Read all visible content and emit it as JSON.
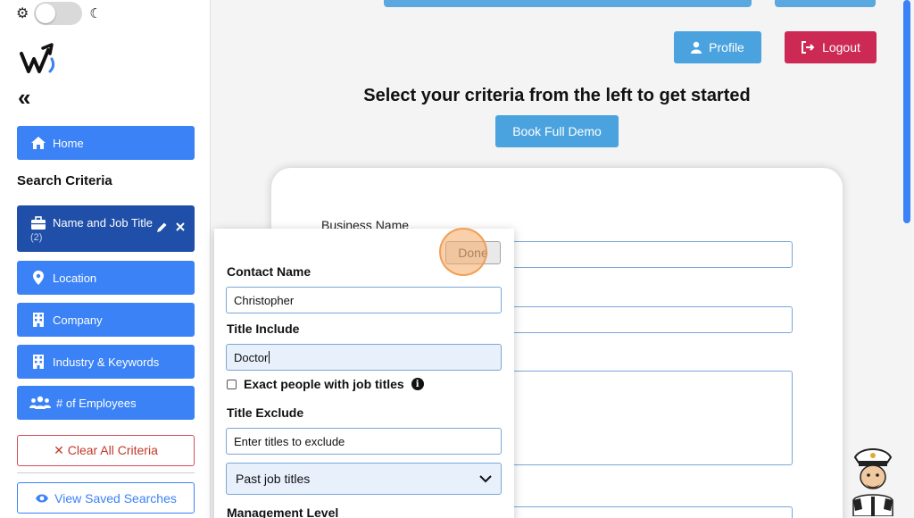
{
  "sidebar": {
    "collapse_glyph": "«",
    "nav_home": "Home",
    "section_title": "Search Criteria",
    "items": [
      {
        "label": "Name and Job Title",
        "sub": "(2)"
      },
      {
        "label": "Location"
      },
      {
        "label": "Company"
      },
      {
        "label": "Industry & Keywords"
      },
      {
        "label": "# of Employees"
      }
    ],
    "clear_label": "✕ Clear All Criteria",
    "saved_label": "View Saved Searches"
  },
  "header": {
    "profile_label": "Profile",
    "logout_label": "Logout",
    "headline": "Select your criteria from the left to get started",
    "demo_label": "Book Full Demo"
  },
  "card": {
    "business_label": "Business Name"
  },
  "popup": {
    "done_label": "Done",
    "contact_label": "Contact Name",
    "contact_value": "Christopher",
    "title_include_label": "Title Include",
    "title_include_value": "Doctor",
    "exact_label": "Exact people with job titles",
    "title_exclude_label": "Title Exclude",
    "title_exclude_value": "Enter titles to exclude",
    "select_value": "Past job titles",
    "cut_label": "Management Level"
  },
  "colors": {
    "primary": "#3b82f6",
    "active_nav": "#1f4fa8",
    "profile": "#4aa3df",
    "logout": "#cc2a55"
  },
  "icons": [
    "gear-icon",
    "moon-icon",
    "home-icon",
    "briefcase-icon",
    "pencil-icon",
    "close-icon",
    "map-pin-icon",
    "building-icon",
    "users-icon",
    "eye-icon",
    "user-icon",
    "logout-icon",
    "info-icon",
    "chevron-down-icon"
  ]
}
